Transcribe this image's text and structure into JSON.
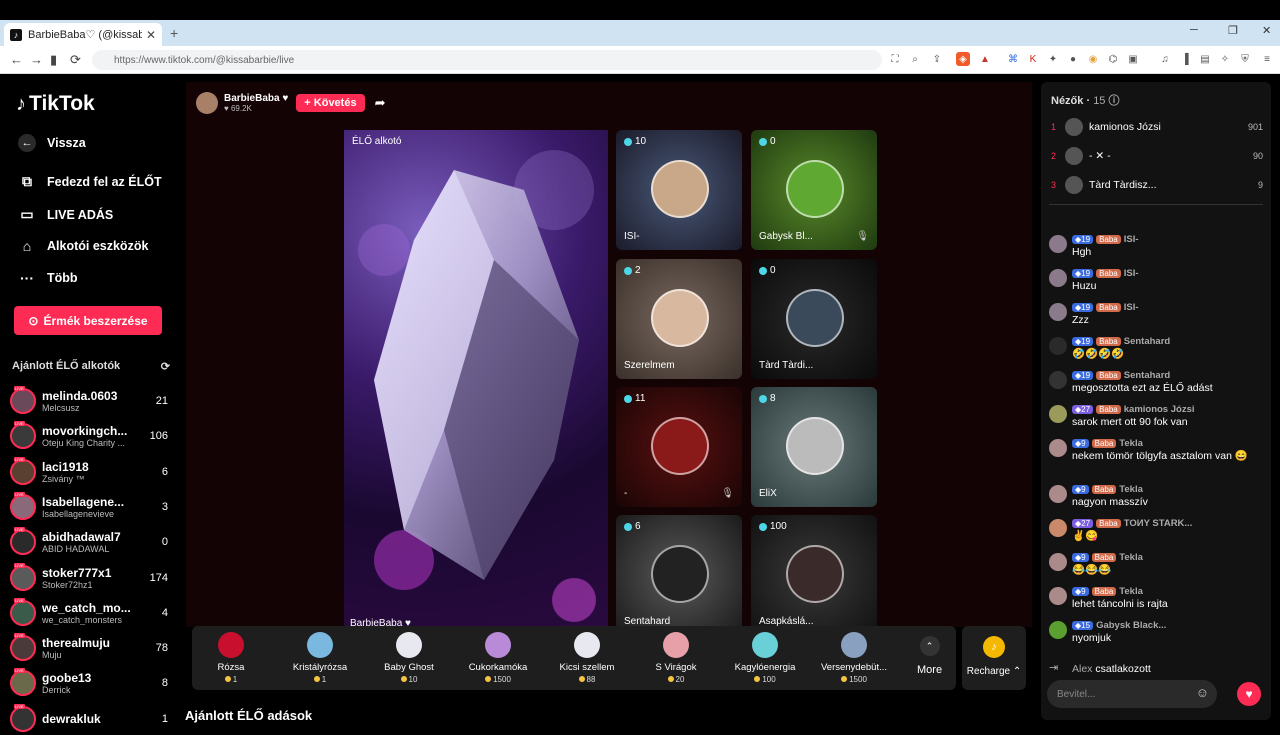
{
  "browser": {
    "tab_title": "BarbieBaba♡ (@kissabarbie",
    "url": "https://www.tiktok.com/@kissabarbie/live"
  },
  "sidebar": {
    "logo": "TikTok",
    "back": "Vissza",
    "nav": [
      "Fedezd fel az ÉLŐT",
      "LIVE ADÁS",
      "Alkotói eszközök",
      "Több"
    ],
    "coin_button": "Érmék beszerzése",
    "section_title": "Ajánlott ÉLŐ alkotók",
    "creators": [
      {
        "name": "melinda.0603",
        "sub": "Melcsusz",
        "count": "21"
      },
      {
        "name": "movorkingch...",
        "sub": "Oteju King Charity ...",
        "count": "106"
      },
      {
        "name": "laci1918",
        "sub": "Zsivány ™",
        "count": "6"
      },
      {
        "name": "Isabellagene...",
        "sub": "Isabellagenevieve",
        "count": "3"
      },
      {
        "name": "abidhadawal7",
        "sub": "ABID HADAWAL",
        "count": "0"
      },
      {
        "name": "stoker777x1",
        "sub": "Stoker72hz1",
        "count": "174"
      },
      {
        "name": "we_catch_mo...",
        "sub": "we_catch_monsters",
        "count": "4"
      },
      {
        "name": "therealmuju",
        "sub": "Muju",
        "count": "78"
      },
      {
        "name": "goobe13",
        "sub": "Derrick",
        "count": "8"
      },
      {
        "name": "dewrakluk",
        "sub": "",
        "count": "1"
      }
    ]
  },
  "host": {
    "name": "BarbieBaba",
    "likes": "69.2K",
    "follow": "+ Követés"
  },
  "stage": {
    "main_label": "ÉLŐ alkotó",
    "main_name": "BarbieBaba",
    "tiles": [
      {
        "count": "10",
        "name": "ISI-"
      },
      {
        "count": "0",
        "name": "Gabysk Bl..."
      },
      {
        "count": "2",
        "name": "Szerelmem"
      },
      {
        "count": "0",
        "name": "Tàrd Tàrdi..."
      },
      {
        "count": "11",
        "name": "-"
      },
      {
        "count": "8",
        "name": "EliX"
      },
      {
        "count": "6",
        "name": "Sentahard"
      },
      {
        "count": "100",
        "name": "Asapkáslá..."
      }
    ]
  },
  "gifts": [
    {
      "name": "Rózsa",
      "price": "1"
    },
    {
      "name": "Kristályrózsa",
      "price": "1"
    },
    {
      "name": "Baby Ghost",
      "price": "10"
    },
    {
      "name": "Cukorkamóka",
      "price": "1500"
    },
    {
      "name": "Kicsi szellem",
      "price": "88"
    },
    {
      "name": "S Virágok",
      "price": "20"
    },
    {
      "name": "Kagylóenergia",
      "price": "100"
    },
    {
      "name": "Versenydebüt...",
      "price": "1500"
    }
  ],
  "more_label": "More",
  "recharge_label": "Recharge",
  "recommended_title": "Ajánlott ÉLŐ adások",
  "viewers": {
    "title": "Nézők",
    "count": "15",
    "top": [
      {
        "rank": "1",
        "name": "kamionos Józsi",
        "score": "901"
      },
      {
        "rank": "2",
        "name": "- ✕ -",
        "score": "90"
      },
      {
        "rank": "3",
        "name": "Tàrd Tàrdisz...",
        "score": "9"
      }
    ]
  },
  "chat": [
    {
      "level": "19",
      "fan": "Baba",
      "user": "ISI-",
      "text": "Hgh"
    },
    {
      "level": "19",
      "fan": "Baba",
      "user": "ISI-",
      "text": "Huzu"
    },
    {
      "level": "19",
      "fan": "Baba",
      "user": "ISI-",
      "text": "Zzz"
    },
    {
      "level": "19",
      "fan": "Baba",
      "user": "Sentahard",
      "text": "🤣🤣🤣🤣"
    },
    {
      "level": "19",
      "fan": "Baba",
      "user": "Sentahard",
      "text": "megosztotta ezt az ÉLŐ adást"
    },
    {
      "level": "27",
      "fan": "Baba",
      "user": "kamionos Józsi",
      "text": "sarok mert ott 90 fok van"
    },
    {
      "level": "9",
      "fan": "Baba",
      "user": "Tekla",
      "text": "nekem tömör tölgyfa asztalom van 😄"
    },
    {
      "level": "9",
      "fan": "Baba",
      "user": "Tekla",
      "text": "nagyon masszív"
    },
    {
      "level": "27",
      "fan": "Baba",
      "user": "TOИY STARK...",
      "text": "✌️😋"
    },
    {
      "level": "9",
      "fan": "Baba",
      "user": "Tekla",
      "text": "😂😂😂"
    },
    {
      "level": "9",
      "fan": "Baba",
      "user": "Tekla",
      "text": "lehet táncolni is rajta"
    },
    {
      "level": "15",
      "fan": "",
      "user": "Gabysk Black...",
      "text": "nyomjuk"
    }
  ],
  "join": {
    "user": "Alex",
    "text": "csatlakozott"
  },
  "input_placeholder": "Bevitel..."
}
